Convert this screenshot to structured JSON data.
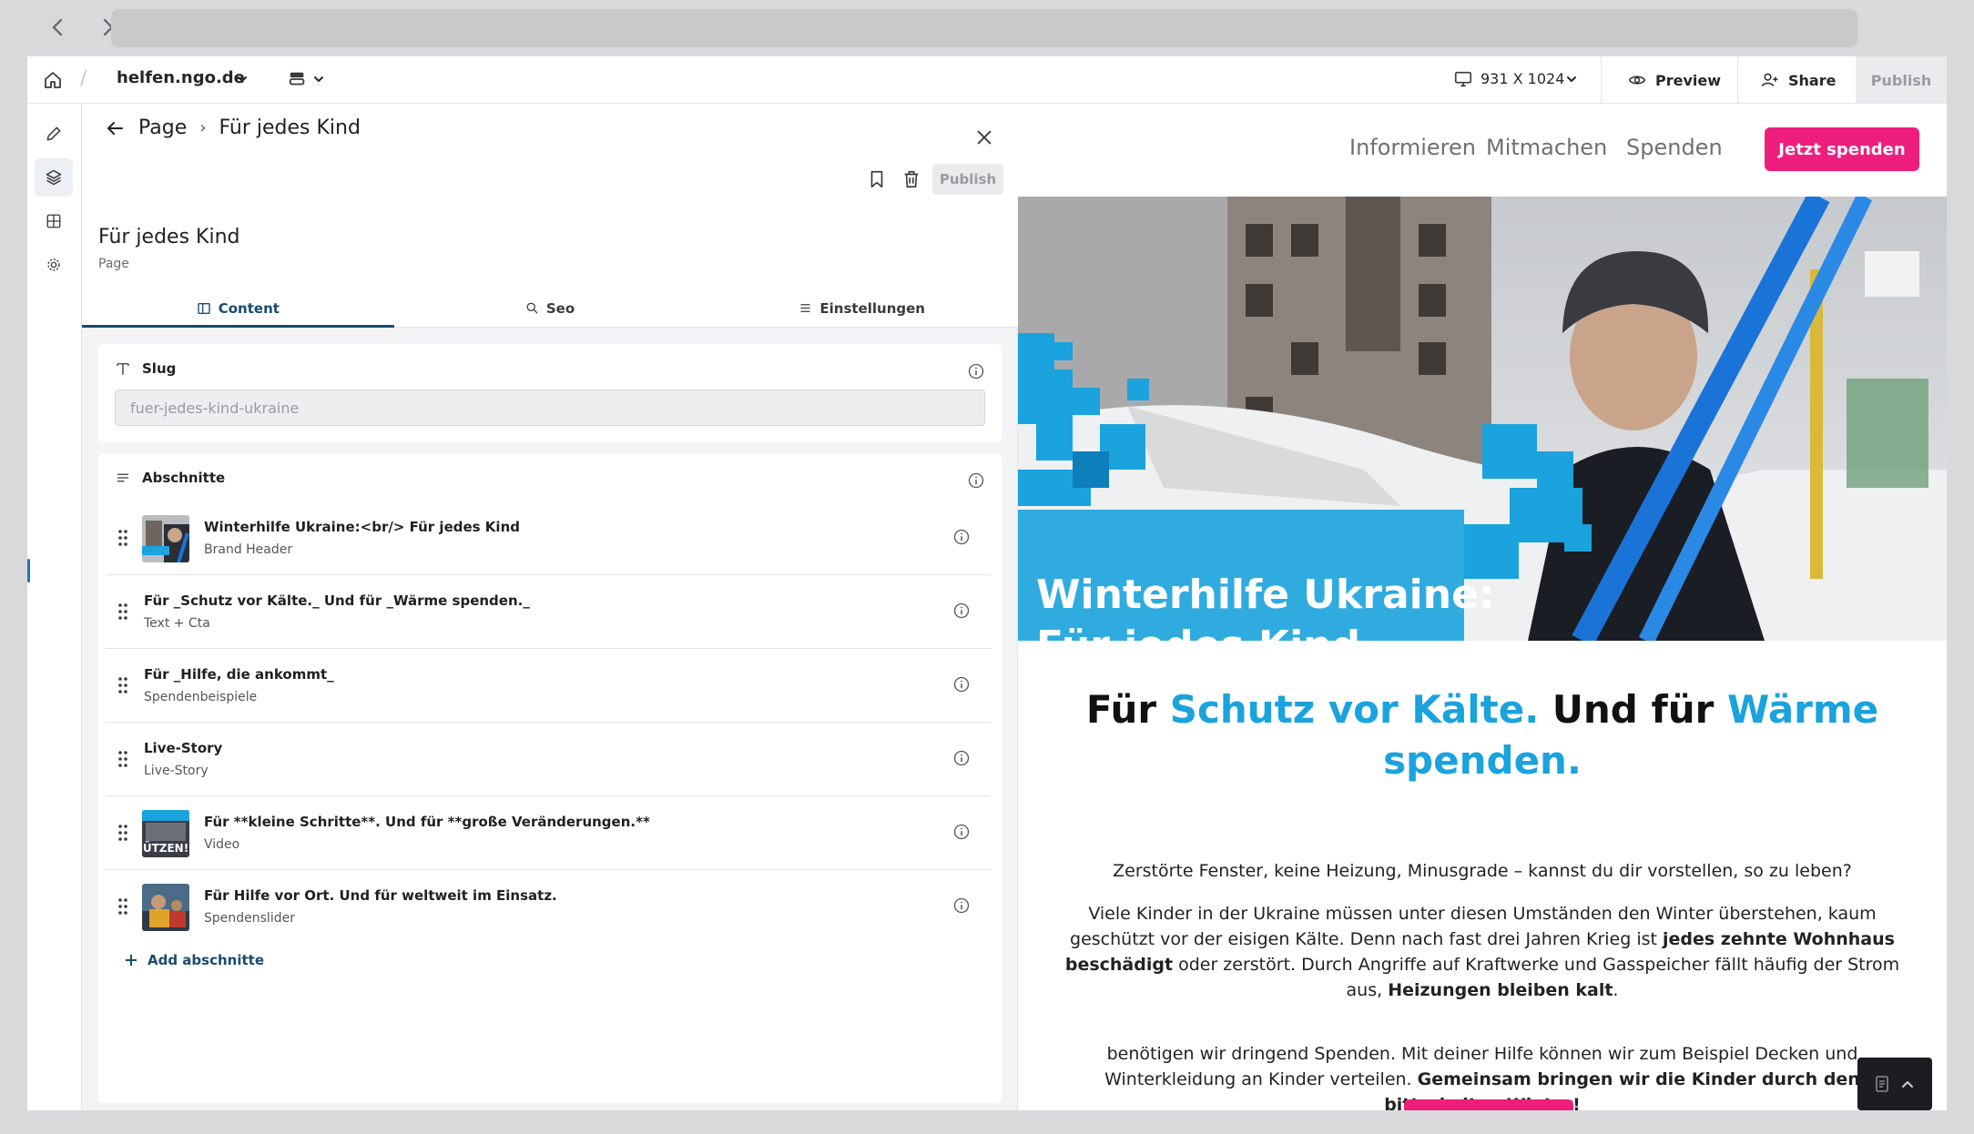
{
  "topbar": {
    "site_name": "helfen.ngo.de",
    "device_size": "931 X 1024",
    "preview_label": "Preview",
    "share_label": "Share",
    "publish_label": "Publish"
  },
  "panel": {
    "breadcrumb_root": "Page",
    "breadcrumb_current": "Für jedes Kind",
    "publish_label": "Publish",
    "entry_title": "Für jedes Kind",
    "entry_type": "Page",
    "tabs": [
      {
        "label": "Content",
        "icon": "columns-icon"
      },
      {
        "label": "Seo",
        "icon": "search-icon"
      },
      {
        "label": "Einstellungen",
        "icon": "list-icon"
      }
    ],
    "slug": {
      "label": "Slug",
      "value": "fuer-jedes-kind-ukraine"
    },
    "sections": {
      "label": "Abschnitte",
      "items": [
        {
          "title": "Winterhilfe Ukraine:<br/> Für jedes Kind",
          "type": "Brand Header",
          "thumb": true
        },
        {
          "title": "Für _Schutz vor Kälte._ Und für _Wärme spenden._",
          "type": "Text + Cta",
          "thumb": false
        },
        {
          "title": "Für _Hilfe, die ankommt_",
          "type": "Spendenbeispiele",
          "thumb": false
        },
        {
          "title": "Live-Story",
          "type": "Live-Story",
          "thumb": false
        },
        {
          "title": "Für **kleine Schritte**. Und für **große Veränderungen.**",
          "type": "Video",
          "thumb": true
        },
        {
          "title": "Für Hilfe vor Ort. Und für weltweit im Einsatz.",
          "type": "Spendenslider",
          "thumb": true
        }
      ],
      "add_label": "Add abschnitte",
      "thumb_text": "ÜTZEN!"
    }
  },
  "preview": {
    "nav": [
      "Informieren",
      "Mitmachen",
      "Spenden"
    ],
    "cta_label": "Jetzt spenden",
    "hero_line1": "Winterhilfe Ukraine:",
    "hero_line2": "Für jedes Kind",
    "headline": {
      "a": "Für ",
      "b": "Schutz vor Kälte.",
      "c": " Und für ",
      "d": "Wärme spenden."
    },
    "p1": "Zerstörte Fenster, keine Heizung, Minusgrade – kannst du dir vorstellen, so zu leben?",
    "p2": {
      "a": "Viele Kinder in der Ukraine müssen unter diesen Umständen den Winter überstehen, kaum geschützt vor der eisigen Kälte. Denn nach fast drei Jahren Krieg ist ",
      "b": "jedes zehnte Wohnhaus beschädigt",
      "c": " oder zerstört. Durch Angriffe auf Kraftwerke und Gasspeicher fällt häufig der Strom aus, ",
      "d": "Heizungen bleiben kalt",
      "e": "."
    },
    "p3": {
      "a": "benötigen wir dringend Spenden. Mit deiner Hilfe können wir zum Beispiel Decken und Winterkleidung an Kinder verteilen. ",
      "b": "Gemeinsam bringen wir die Kinder durch den bitterkalten Winter!"
    }
  },
  "colors": {
    "brand_pink": "#ee1f7c",
    "brand_blue": "#1aa3dd",
    "tab_active": "#1a4a6e"
  }
}
